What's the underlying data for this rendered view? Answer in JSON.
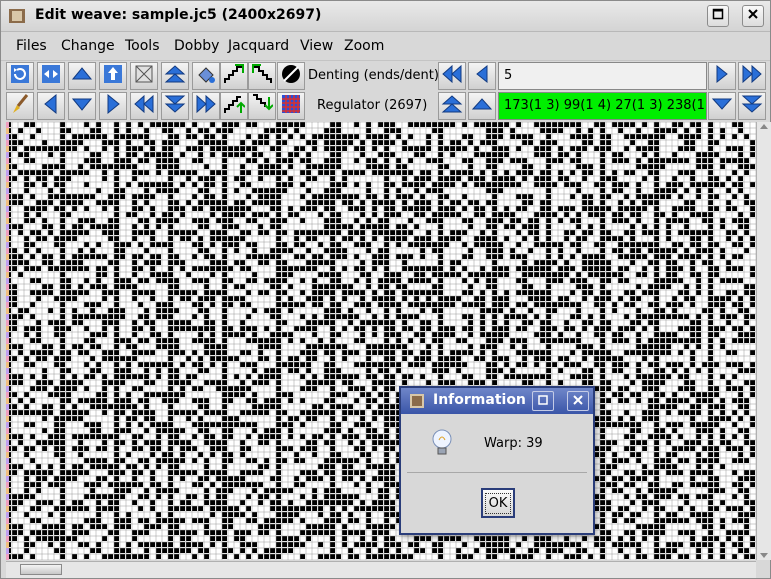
{
  "window": {
    "title": "Edit weave: sample.jc5 (2400x2697)",
    "icons": {
      "app": "sample-icon",
      "maximize": "maximize-icon",
      "close": "close-icon"
    }
  },
  "menu": [
    "Files",
    "Change",
    "Tools",
    "Dobby",
    "Jacquard",
    "View",
    "Zoom"
  ],
  "toolbar": {
    "row1_icons": [
      "refresh-icon",
      "swap-horizontal-icon",
      "arrow-up-icon",
      "move-up-icon",
      "scale-icon",
      "double-arrow-up-icon",
      "fill-icon",
      "stairs-right-icon",
      "stairs-left-icon",
      "invert-icon"
    ],
    "row2_icons": [
      "brush-icon",
      "arrow-left-icon",
      "arrow-down-icon",
      "arrow-right-icon",
      "fast-left-icon",
      "double-arrow-down-icon",
      "fast-right-icon",
      "twill-up-icon",
      "twill-down-icon",
      "pattern-icon"
    ],
    "denting_label": "Denting (ends/dent)",
    "denting_value": "5",
    "regulator_label": "Regulator (2697)",
    "regulator_value": "173(1 3) 99(1 4) 27(1 3) 238(1"
  },
  "dialog": {
    "title": "Information",
    "icon": "lightbulb-icon",
    "message": "Warp: 39",
    "ok_label": "OK"
  },
  "colors": {
    "regulator_bg": "#00ee00",
    "dialog_title": "#3a55a8",
    "weave_ink": "#000000"
  }
}
